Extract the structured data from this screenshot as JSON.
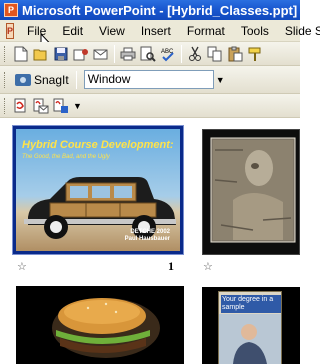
{
  "window": {
    "title": "Microsoft PowerPoint - [Hybrid_Classes.ppt]"
  },
  "menubar": {
    "items": [
      "File",
      "Edit",
      "View",
      "Insert",
      "Format",
      "Tools",
      "Slide S"
    ]
  },
  "toolbar_standard": {
    "icons": [
      "new-icon",
      "open-icon",
      "save-icon",
      "permission-icon",
      "email-icon",
      "print-icon",
      "print-preview-icon",
      "spelling-icon",
      "cut-icon",
      "copy-icon",
      "paste-icon",
      "format-painter-icon"
    ]
  },
  "toolbar_snagit": {
    "snagit_label": "SnagIt",
    "capture_mode": "Window"
  },
  "toolbar_pdf": {
    "icons": [
      "convert-to-pdf-icon",
      "pdf-attach-email-icon",
      "pdf-review-icon"
    ]
  },
  "slides": [
    {
      "number": "1",
      "title": "Hybrid Course Development:",
      "subtitle": "The Good, the Bad, and the Ugly",
      "caption_line1": "DETCHE 2002",
      "caption_line2": "Paul Hausbauer"
    },
    {
      "number": ""
    },
    {
      "number": ""
    },
    {
      "number": "",
      "panel_text": "Your degree in a sample"
    }
  ]
}
